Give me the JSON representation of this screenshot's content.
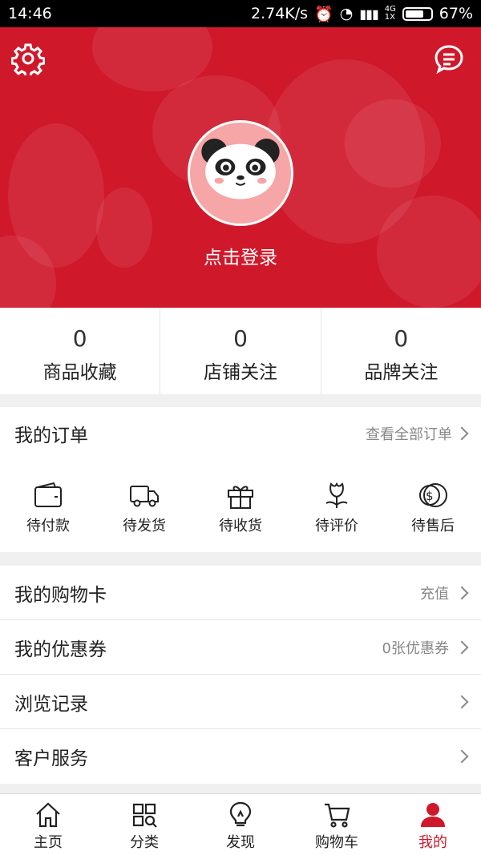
{
  "status_bar": {
    "time": "14:46",
    "network_speed": "2.74K/s",
    "network_type": "4G 1X",
    "battery": "67%"
  },
  "profile": {
    "login_text": "点击登录"
  },
  "stats": [
    {
      "count": "0",
      "label": "商品收藏"
    },
    {
      "count": "0",
      "label": "店铺关注"
    },
    {
      "count": "0",
      "label": "品牌关注"
    }
  ],
  "orders": {
    "title": "我的订单",
    "view_all": "查看全部订单",
    "items": [
      {
        "label": "待付款",
        "icon": "wallet-icon"
      },
      {
        "label": "待发货",
        "icon": "truck-icon"
      },
      {
        "label": "待收货",
        "icon": "gift-icon"
      },
      {
        "label": "待评价",
        "icon": "flower-icon"
      },
      {
        "label": "待售后",
        "icon": "coins-icon"
      }
    ]
  },
  "menu": [
    {
      "title": "我的购物卡",
      "value": "充值"
    },
    {
      "title": "我的优惠券",
      "value": "0张优惠券"
    },
    {
      "title": "浏览记录",
      "value": ""
    },
    {
      "title": "客户服务",
      "value": ""
    }
  ],
  "tabs": [
    {
      "label": "主页",
      "icon": "home-icon"
    },
    {
      "label": "分类",
      "icon": "category-icon"
    },
    {
      "label": "发现",
      "icon": "bulb-icon"
    },
    {
      "label": "购物车",
      "icon": "cart-icon"
    },
    {
      "label": "我的",
      "icon": "user-icon",
      "active": true
    }
  ],
  "colors": {
    "brand": "#d0182b",
    "avatar_bg": "#f6a6a6"
  }
}
